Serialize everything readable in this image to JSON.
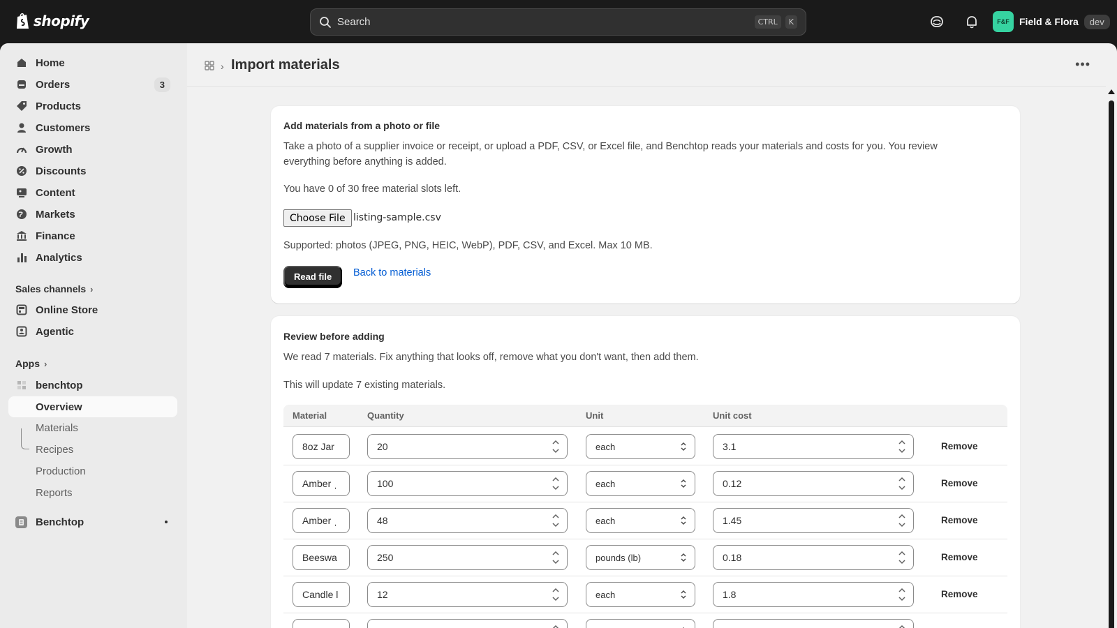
{
  "topbar": {
    "logo_text": "shopify",
    "search_placeholder": "Search",
    "shortcut_1": "CTRL",
    "shortcut_2": "K",
    "avatar_initials": "F&F",
    "store_name": "Field & Flora",
    "env_badge": "dev"
  },
  "sidebar": {
    "items": [
      {
        "label": "Home",
        "icon": "home-icon"
      },
      {
        "label": "Orders",
        "icon": "orders-icon",
        "badge": "3"
      },
      {
        "label": "Products",
        "icon": "tag-icon"
      },
      {
        "label": "Customers",
        "icon": "person-icon"
      },
      {
        "label": "Growth",
        "icon": "gauge-icon"
      },
      {
        "label": "Discounts",
        "icon": "discount-icon"
      },
      {
        "label": "Content",
        "icon": "content-icon"
      },
      {
        "label": "Markets",
        "icon": "globe-icon"
      },
      {
        "label": "Finance",
        "icon": "bank-icon"
      },
      {
        "label": "Analytics",
        "icon": "bar-chart-icon"
      }
    ],
    "sales_channels_label": "Sales channels",
    "channels": [
      {
        "label": "Online Store",
        "icon": "store-icon"
      },
      {
        "label": "Agentic",
        "icon": "agentic-icon"
      }
    ],
    "apps_label": "Apps",
    "app_name": "benchtop",
    "app_sub": [
      "Overview",
      "Materials",
      "Recipes",
      "Production",
      "Reports"
    ],
    "pinned_app": "Benchtop"
  },
  "page": {
    "title": "Import materials",
    "more_label": "•••"
  },
  "upload_card": {
    "title": "Add materials from a photo or file",
    "description_line1": "Take a photo of a supplier invoice or receipt, or upload a PDF, CSV, or Excel file, and Benchtop reads your materials and costs for you. You review",
    "description_line2": "everything before anything is added.",
    "slots_text": "You have 0 of 30 free material slots left.",
    "choose_file_label": "Choose File",
    "file_name": "listing-sample.csv",
    "supported_text": "Supported: photos (JPEG, PNG, HEIC, WebP), PDF, CSV, and Excel. Max 10 MB.",
    "read_button": "Read file",
    "back_link": "Back to materials"
  },
  "review_card": {
    "title": "Review before adding",
    "summary": "We read 7 materials. Fix anything that looks off, remove what you don't want, then add them.",
    "update_note": "This will update 7 existing materials.",
    "columns": [
      "Material",
      "Quantity",
      "Unit",
      "Unit cost"
    ],
    "remove_label": "Remove",
    "rows": [
      {
        "material": "8oz Jar",
        "quantity": "20",
        "unit": "each",
        "cost": "3.1"
      },
      {
        "material": "Amber ˌ",
        "quantity": "100",
        "unit": "each",
        "cost": "0.12"
      },
      {
        "material": "Amber ˌ",
        "quantity": "48",
        "unit": "each",
        "cost": "1.45"
      },
      {
        "material": "Beeswa",
        "quantity": "250",
        "unit": "pounds (lb)",
        "cost": "0.18"
      },
      {
        "material": "Candle l",
        "quantity": "12",
        "unit": "each",
        "cost": "1.8"
      },
      {
        "material": "",
        "quantity": "",
        "unit": "",
        "cost": ""
      }
    ]
  }
}
